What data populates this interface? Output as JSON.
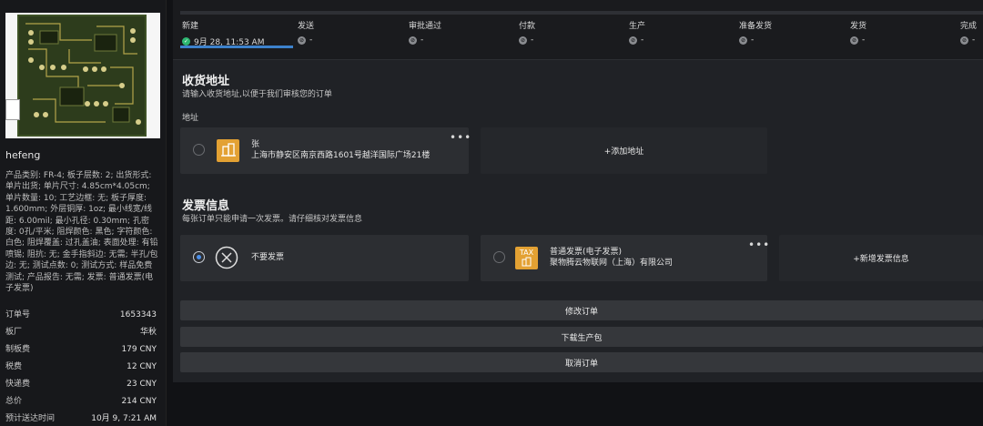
{
  "sidebar": {
    "user": "hefeng",
    "specs": "产品类别: FR-4; 板子层数: 2; 出货形式: 单片出货; 单片尺寸: 4.85cm*4.05cm; 单片数量: 10; 工艺边框: 无; 板子厚度: 1.600mm; 外层铜厚: 1oz; 最小线宽/线距: 6.00mil; 最小孔径: 0.30mm; 孔密度: 0孔/平米; 阻焊颜色: 黑色; 字符颜色: 白色; 阻焊覆盖: 过孔盖油; 表面处理: 有铅喷锡; 阻抗: 无; 金手指斜边: 无需; 半孔/包边: 无; 测试点数: 0; 测试方式: 样品免费测试; 产品报告: 无需; 发票: 普通发票(电子发票)",
    "fees": [
      {
        "label": "订单号",
        "value": "1653343"
      },
      {
        "label": "板厂",
        "value": "华秋"
      },
      {
        "label": "制板费",
        "value": "179 CNY"
      },
      {
        "label": "税费",
        "value": "12 CNY"
      },
      {
        "label": "快递费",
        "value": "23 CNY"
      },
      {
        "label": "总价",
        "value": "214 CNY"
      },
      {
        "label": "预计送达时间",
        "value": "10月 9, 7:21 AM"
      }
    ]
  },
  "steps": [
    {
      "name": "新建",
      "value": "9月 28, 11:53 AM",
      "done": true
    },
    {
      "name": "发送",
      "value": "-",
      "done": false
    },
    {
      "name": "审批通过",
      "value": "-",
      "done": false
    },
    {
      "name": "付款",
      "value": "-",
      "done": false
    },
    {
      "name": "生产",
      "value": "-",
      "done": false
    },
    {
      "name": "准备发货",
      "value": "-",
      "done": false
    },
    {
      "name": "发货",
      "value": "-",
      "done": false
    },
    {
      "name": "完成",
      "value": "-",
      "done": false
    }
  ],
  "address": {
    "title": "收货地址",
    "desc": "请输入收货地址,以便于我们审核您的订单",
    "field_label": "地址",
    "card": {
      "name": "张",
      "line": "上海市静安区南京西路1601号越洋国际广场21楼"
    },
    "more": "•••",
    "add_label": "+添加地址"
  },
  "invoice": {
    "title": "发票信息",
    "desc": "每张订单只能申请一次发票。请仔细核对发票信息",
    "none_label": "不要发票",
    "tax_tile": "TAX",
    "card": {
      "type": "普通发票(电子发票)",
      "company": "聚物腾云物联网（上海）有限公司"
    },
    "more": "•••",
    "add_label": "+新增发票信息"
  },
  "actions": {
    "modify": "修改订单",
    "download": "下载生产包",
    "cancel": "取消订单"
  },
  "colors": {
    "accent": "#3d82cc",
    "done": "#2eb872",
    "tile": "#e3a133"
  }
}
